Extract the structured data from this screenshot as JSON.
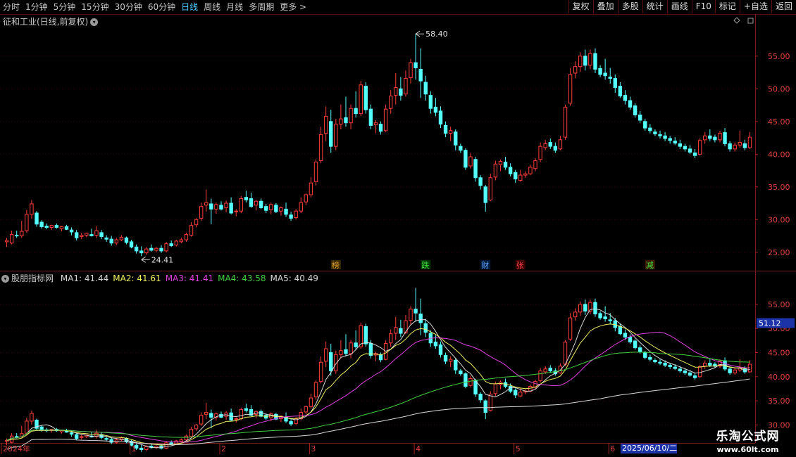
{
  "toolbar": {
    "periods": [
      "分时",
      "1分钟",
      "5分钟",
      "15分钟",
      "30分钟",
      "60分钟",
      "日线",
      "周线",
      "月线",
      "多周期",
      "更多 >"
    ],
    "active_period": "日线",
    "actions": [
      "复权",
      "叠加",
      "多股",
      "统计",
      "画线",
      "F10",
      "标记",
      "+自选",
      "返回"
    ]
  },
  "main_panel": {
    "title": "征和工业(日线,前复权)",
    "title_color": "#c8c8c8"
  },
  "indicator_panel": {
    "name": "股朋指标网",
    "ma": [
      {
        "label": "MA1: 41.44",
        "color": "#d8d8d8"
      },
      {
        "label": "MA2: 41.61",
        "color": "#f0f060"
      },
      {
        "label": "MA3: 41.41",
        "color": "#e040e0"
      },
      {
        "label": "MA4: 43.58",
        "color": "#40d040"
      },
      {
        "label": "MA5: 40.49",
        "color": "#d8d8d8"
      }
    ],
    "current_price_tag": "51.12"
  },
  "event_markers": [
    {
      "label": "榜",
      "color": "#e0a030",
      "bg": "#3a2a00"
    },
    {
      "label": "跌",
      "color": "#40e040",
      "bg": "#003a00"
    },
    {
      "label": "财",
      "color": "#60a0ff",
      "bg": "#001a3a"
    },
    {
      "label": "张",
      "color": "#ff4040",
      "bg": "#3a0000"
    },
    {
      "label": "减",
      "color": "#40e040",
      "bg": "#3a1a00"
    }
  ],
  "annotations": {
    "high": "58.40",
    "low": "24.41"
  },
  "x_axis": {
    "labels": [
      "2024年",
      "1",
      "2",
      "3",
      "4",
      "5",
      "6"
    ],
    "cursor_date": "2025/06/10/二"
  },
  "watermark": {
    "line1": "乐淘公式网",
    "line2": "www.60lt.com"
  },
  "chart_data": {
    "type": "candlestick",
    "title": "征和工业(日线,前复权)",
    "y_ticks_main": [
      25.0,
      30.0,
      35.0,
      40.0,
      45.0,
      50.0,
      55.0
    ],
    "y_ticks_indicator": [
      30.0,
      35.0,
      40.0,
      45.0,
      50.0,
      55.0
    ],
    "ylim": [
      22.5,
      59.5
    ],
    "colors": {
      "up": "#ff3c3c",
      "down": "#54ffff",
      "ma1": "#d8d8d8",
      "ma2": "#f0f060",
      "ma3": "#e040e0",
      "ma4": "#40d040",
      "ma5": "#d8d8d8"
    },
    "candles": [
      {
        "o": 26.6,
        "h": 27.2,
        "l": 25.8,
        "c": 26.8
      },
      {
        "o": 26.4,
        "h": 28.3,
        "l": 26.2,
        "c": 27.7
      },
      {
        "o": 27.6,
        "h": 28.3,
        "l": 27.2,
        "c": 27.5
      },
      {
        "o": 27.5,
        "h": 29.8,
        "l": 27.2,
        "c": 28.2
      },
      {
        "o": 28.3,
        "h": 31.5,
        "l": 28.0,
        "c": 30.8
      },
      {
        "o": 30.8,
        "h": 33.0,
        "l": 30.1,
        "c": 32.4
      },
      {
        "o": 31.0,
        "h": 31.3,
        "l": 28.9,
        "c": 29.3
      },
      {
        "o": 29.6,
        "h": 29.9,
        "l": 28.6,
        "c": 28.9
      },
      {
        "o": 29.0,
        "h": 29.4,
        "l": 28.5,
        "c": 28.8
      },
      {
        "o": 28.8,
        "h": 29.2,
        "l": 28.4,
        "c": 29.1
      },
      {
        "o": 29.1,
        "h": 29.4,
        "l": 28.6,
        "c": 28.8
      },
      {
        "o": 28.6,
        "h": 29.0,
        "l": 28.2,
        "c": 28.9
      },
      {
        "o": 28.9,
        "h": 29.2,
        "l": 28.4,
        "c": 28.5
      },
      {
        "o": 28.4,
        "h": 28.8,
        "l": 27.6,
        "c": 28.1
      },
      {
        "o": 28.0,
        "h": 28.4,
        "l": 26.8,
        "c": 27.2
      },
      {
        "o": 27.4,
        "h": 28.0,
        "l": 27.0,
        "c": 27.6
      },
      {
        "o": 27.6,
        "h": 28.0,
        "l": 27.3,
        "c": 27.9
      },
      {
        "o": 27.7,
        "h": 28.6,
        "l": 27.4,
        "c": 27.5
      },
      {
        "o": 27.6,
        "h": 29.0,
        "l": 27.2,
        "c": 28.3
      },
      {
        "o": 28.0,
        "h": 28.4,
        "l": 27.0,
        "c": 27.4
      },
      {
        "o": 27.2,
        "h": 27.6,
        "l": 26.6,
        "c": 27.0
      },
      {
        "o": 27.0,
        "h": 27.5,
        "l": 26.0,
        "c": 26.4
      },
      {
        "o": 26.4,
        "h": 27.2,
        "l": 26.1,
        "c": 26.9
      },
      {
        "o": 26.9,
        "h": 27.6,
        "l": 26.7,
        "c": 27.3
      },
      {
        "o": 27.2,
        "h": 27.4,
        "l": 26.2,
        "c": 26.5
      },
      {
        "o": 26.6,
        "h": 26.9,
        "l": 25.6,
        "c": 25.8
      },
      {
        "o": 25.8,
        "h": 26.2,
        "l": 24.8,
        "c": 25.2
      },
      {
        "o": 25.2,
        "h": 25.9,
        "l": 24.4,
        "c": 24.9
      },
      {
        "o": 24.9,
        "h": 25.8,
        "l": 24.6,
        "c": 25.5
      },
      {
        "o": 25.6,
        "h": 26.2,
        "l": 25.1,
        "c": 25.3
      },
      {
        "o": 25.3,
        "h": 25.8,
        "l": 25.0,
        "c": 25.6
      },
      {
        "o": 25.6,
        "h": 26.1,
        "l": 24.9,
        "c": 25.2
      },
      {
        "o": 25.2,
        "h": 26.6,
        "l": 25.0,
        "c": 26.3
      },
      {
        "o": 26.3,
        "h": 26.8,
        "l": 25.8,
        "c": 26.0
      },
      {
        "o": 26.1,
        "h": 26.9,
        "l": 25.9,
        "c": 26.7
      },
      {
        "o": 26.6,
        "h": 27.2,
        "l": 26.4,
        "c": 26.9
      },
      {
        "o": 26.9,
        "h": 28.0,
        "l": 26.6,
        "c": 27.7
      },
      {
        "o": 27.6,
        "h": 29.6,
        "l": 27.4,
        "c": 29.1
      },
      {
        "o": 29.2,
        "h": 30.2,
        "l": 28.8,
        "c": 30.0
      },
      {
        "o": 30.2,
        "h": 32.6,
        "l": 29.8,
        "c": 32.0
      },
      {
        "o": 32.2,
        "h": 34.6,
        "l": 31.2,
        "c": 32.6
      },
      {
        "o": 32.4,
        "h": 33.2,
        "l": 29.3,
        "c": 31.6
      },
      {
        "o": 31.6,
        "h": 32.6,
        "l": 30.9,
        "c": 32.3
      },
      {
        "o": 32.2,
        "h": 32.8,
        "l": 31.4,
        "c": 31.6
      },
      {
        "o": 31.8,
        "h": 32.9,
        "l": 31.1,
        "c": 32.5
      },
      {
        "o": 32.5,
        "h": 33.4,
        "l": 30.8,
        "c": 31.0
      },
      {
        "o": 31.2,
        "h": 31.6,
        "l": 30.5,
        "c": 31.3
      },
      {
        "o": 31.3,
        "h": 33.6,
        "l": 31.0,
        "c": 33.2
      },
      {
        "o": 33.4,
        "h": 34.4,
        "l": 32.6,
        "c": 33.0
      },
      {
        "o": 33.2,
        "h": 34.1,
        "l": 31.8,
        "c": 32.0
      },
      {
        "o": 32.2,
        "h": 33.0,
        "l": 31.4,
        "c": 32.8
      },
      {
        "o": 32.8,
        "h": 33.2,
        "l": 31.6,
        "c": 31.8
      },
      {
        "o": 32.0,
        "h": 32.4,
        "l": 31.0,
        "c": 31.4
      },
      {
        "o": 31.5,
        "h": 32.6,
        "l": 30.8,
        "c": 32.3
      },
      {
        "o": 32.2,
        "h": 32.5,
        "l": 31.0,
        "c": 31.2
      },
      {
        "o": 31.3,
        "h": 32.0,
        "l": 30.6,
        "c": 31.8
      },
      {
        "o": 31.6,
        "h": 32.6,
        "l": 30.4,
        "c": 30.8
      },
      {
        "o": 30.7,
        "h": 31.2,
        "l": 29.8,
        "c": 30.2
      },
      {
        "o": 30.3,
        "h": 31.6,
        "l": 30.0,
        "c": 31.3
      },
      {
        "o": 31.3,
        "h": 33.4,
        "l": 31.0,
        "c": 32.6
      },
      {
        "o": 32.7,
        "h": 34.0,
        "l": 32.2,
        "c": 33.8
      },
      {
        "o": 33.8,
        "h": 36.5,
        "l": 33.4,
        "c": 35.6
      },
      {
        "o": 35.8,
        "h": 39.2,
        "l": 35.2,
        "c": 38.8
      },
      {
        "o": 39.0,
        "h": 44.2,
        "l": 38.6,
        "c": 43.0
      },
      {
        "o": 43.2,
        "h": 47.3,
        "l": 42.0,
        "c": 45.8
      },
      {
        "o": 45.0,
        "h": 46.8,
        "l": 40.2,
        "c": 41.2
      },
      {
        "o": 41.2,
        "h": 45.4,
        "l": 40.6,
        "c": 44.6
      },
      {
        "o": 44.6,
        "h": 47.6,
        "l": 43.8,
        "c": 45.4
      },
      {
        "o": 45.6,
        "h": 48.8,
        "l": 44.2,
        "c": 44.8
      },
      {
        "o": 44.8,
        "h": 47.6,
        "l": 43.8,
        "c": 47.0
      },
      {
        "o": 47.0,
        "h": 49.6,
        "l": 45.6,
        "c": 46.2
      },
      {
        "o": 46.2,
        "h": 51.2,
        "l": 45.8,
        "c": 50.6
      },
      {
        "o": 50.4,
        "h": 51.0,
        "l": 46.2,
        "c": 46.8
      },
      {
        "o": 46.9,
        "h": 47.6,
        "l": 43.8,
        "c": 44.4
      },
      {
        "o": 44.5,
        "h": 45.2,
        "l": 43.2,
        "c": 44.8
      },
      {
        "o": 44.6,
        "h": 45.0,
        "l": 43.0,
        "c": 43.5
      },
      {
        "o": 43.6,
        "h": 47.6,
        "l": 43.4,
        "c": 46.9
      },
      {
        "o": 47.0,
        "h": 49.8,
        "l": 46.2,
        "c": 48.9
      },
      {
        "o": 49.0,
        "h": 52.4,
        "l": 47.6,
        "c": 50.2
      },
      {
        "o": 50.0,
        "h": 51.8,
        "l": 48.2,
        "c": 49.0
      },
      {
        "o": 49.2,
        "h": 52.8,
        "l": 48.8,
        "c": 51.6
      },
      {
        "o": 51.7,
        "h": 54.6,
        "l": 50.8,
        "c": 54.0
      },
      {
        "o": 54.0,
        "h": 58.4,
        "l": 51.4,
        "c": 53.2
      },
      {
        "o": 53.0,
        "h": 56.2,
        "l": 48.6,
        "c": 51.2
      },
      {
        "o": 51.0,
        "h": 52.0,
        "l": 48.2,
        "c": 49.2
      },
      {
        "o": 49.0,
        "h": 49.6,
        "l": 46.2,
        "c": 47.0
      },
      {
        "o": 47.2,
        "h": 48.6,
        "l": 45.8,
        "c": 46.4
      },
      {
        "o": 46.6,
        "h": 47.3,
        "l": 44.0,
        "c": 44.6
      },
      {
        "o": 44.4,
        "h": 45.0,
        "l": 42.6,
        "c": 43.2
      },
      {
        "o": 43.2,
        "h": 44.2,
        "l": 42.0,
        "c": 43.6
      },
      {
        "o": 43.4,
        "h": 43.8,
        "l": 40.6,
        "c": 41.4
      },
      {
        "o": 41.2,
        "h": 41.6,
        "l": 40.2,
        "c": 40.6
      },
      {
        "o": 40.6,
        "h": 40.9,
        "l": 37.6,
        "c": 38.0
      },
      {
        "o": 38.2,
        "h": 40.2,
        "l": 37.8,
        "c": 39.6
      },
      {
        "o": 39.2,
        "h": 39.6,
        "l": 35.8,
        "c": 36.4
      },
      {
        "o": 36.4,
        "h": 36.8,
        "l": 34.6,
        "c": 35.2
      },
      {
        "o": 35.0,
        "h": 35.3,
        "l": 31.2,
        "c": 32.6
      },
      {
        "o": 33.0,
        "h": 37.0,
        "l": 32.8,
        "c": 36.4
      },
      {
        "o": 36.5,
        "h": 39.0,
        "l": 36.0,
        "c": 38.5
      },
      {
        "o": 38.4,
        "h": 39.2,
        "l": 37.4,
        "c": 38.9
      },
      {
        "o": 38.8,
        "h": 39.6,
        "l": 37.6,
        "c": 38.0
      },
      {
        "o": 38.0,
        "h": 38.6,
        "l": 36.6,
        "c": 37.0
      },
      {
        "o": 37.2,
        "h": 37.6,
        "l": 35.6,
        "c": 36.2
      },
      {
        "o": 36.0,
        "h": 37.6,
        "l": 35.8,
        "c": 36.8
      },
      {
        "o": 36.8,
        "h": 37.4,
        "l": 36.4,
        "c": 37.0
      },
      {
        "o": 37.0,
        "h": 38.4,
        "l": 36.8,
        "c": 38.0
      },
      {
        "o": 37.8,
        "h": 39.4,
        "l": 37.4,
        "c": 39.0
      },
      {
        "o": 39.2,
        "h": 41.8,
        "l": 38.8,
        "c": 41.2
      },
      {
        "o": 41.0,
        "h": 42.2,
        "l": 40.6,
        "c": 41.6
      },
      {
        "o": 41.8,
        "h": 42.4,
        "l": 40.8,
        "c": 41.2
      },
      {
        "o": 41.2,
        "h": 41.8,
        "l": 40.2,
        "c": 40.6
      },
      {
        "o": 40.8,
        "h": 42.8,
        "l": 40.6,
        "c": 42.2
      },
      {
        "o": 42.6,
        "h": 47.6,
        "l": 42.2,
        "c": 47.2
      },
      {
        "o": 47.8,
        "h": 53.2,
        "l": 47.4,
        "c": 52.2
      },
      {
        "o": 52.4,
        "h": 54.2,
        "l": 51.6,
        "c": 53.4
      },
      {
        "o": 53.4,
        "h": 55.6,
        "l": 52.6,
        "c": 55.0
      },
      {
        "o": 55.0,
        "h": 56.0,
        "l": 52.8,
        "c": 53.6
      },
      {
        "o": 53.6,
        "h": 56.0,
        "l": 53.0,
        "c": 55.4
      },
      {
        "o": 55.4,
        "h": 56.2,
        "l": 52.4,
        "c": 53.0
      },
      {
        "o": 53.1,
        "h": 53.6,
        "l": 51.8,
        "c": 52.2
      },
      {
        "o": 52.4,
        "h": 54.6,
        "l": 51.4,
        "c": 52.0
      },
      {
        "o": 51.8,
        "h": 53.2,
        "l": 50.8,
        "c": 51.6
      },
      {
        "o": 51.6,
        "h": 52.2,
        "l": 49.4,
        "c": 50.2
      },
      {
        "o": 50.4,
        "h": 51.0,
        "l": 48.6,
        "c": 48.9
      },
      {
        "o": 49.0,
        "h": 49.8,
        "l": 47.6,
        "c": 48.2
      },
      {
        "o": 48.2,
        "h": 48.8,
        "l": 46.8,
        "c": 47.2
      },
      {
        "o": 47.4,
        "h": 47.8,
        "l": 45.6,
        "c": 46.0
      },
      {
        "o": 46.0,
        "h": 46.6,
        "l": 44.8,
        "c": 45.2
      },
      {
        "o": 45.0,
        "h": 45.4,
        "l": 43.6,
        "c": 44.0
      },
      {
        "o": 44.0,
        "h": 44.6,
        "l": 43.2,
        "c": 43.6
      },
      {
        "o": 43.4,
        "h": 43.8,
        "l": 42.8,
        "c": 43.1
      },
      {
        "o": 43.0,
        "h": 43.6,
        "l": 42.4,
        "c": 42.8
      },
      {
        "o": 42.8,
        "h": 43.4,
        "l": 42.0,
        "c": 42.4
      },
      {
        "o": 42.4,
        "h": 42.8,
        "l": 41.6,
        "c": 42.1
      },
      {
        "o": 42.0,
        "h": 42.6,
        "l": 41.4,
        "c": 41.7
      },
      {
        "o": 41.6,
        "h": 42.2,
        "l": 40.8,
        "c": 41.2
      },
      {
        "o": 41.2,
        "h": 41.6,
        "l": 40.4,
        "c": 40.8
      },
      {
        "o": 40.8,
        "h": 41.4,
        "l": 40.0,
        "c": 40.3
      },
      {
        "o": 40.2,
        "h": 40.8,
        "l": 39.4,
        "c": 39.8
      },
      {
        "o": 40.0,
        "h": 42.4,
        "l": 39.8,
        "c": 42.1
      },
      {
        "o": 42.2,
        "h": 43.4,
        "l": 41.6,
        "c": 42.8
      },
      {
        "o": 42.8,
        "h": 43.8,
        "l": 42.0,
        "c": 42.4
      },
      {
        "o": 42.6,
        "h": 43.0,
        "l": 41.8,
        "c": 42.2
      },
      {
        "o": 42.2,
        "h": 43.6,
        "l": 41.8,
        "c": 43.2
      },
      {
        "o": 43.3,
        "h": 44.0,
        "l": 41.2,
        "c": 41.6
      },
      {
        "o": 41.6,
        "h": 42.0,
        "l": 40.4,
        "c": 40.8
      },
      {
        "o": 40.8,
        "h": 41.8,
        "l": 40.4,
        "c": 41.4
      },
      {
        "o": 41.4,
        "h": 43.6,
        "l": 41.0,
        "c": 41.8
      },
      {
        "o": 41.6,
        "h": 42.2,
        "l": 40.6,
        "c": 41.0
      },
      {
        "o": 41.0,
        "h": 43.4,
        "l": 40.8,
        "c": 42.6
      }
    ]
  }
}
